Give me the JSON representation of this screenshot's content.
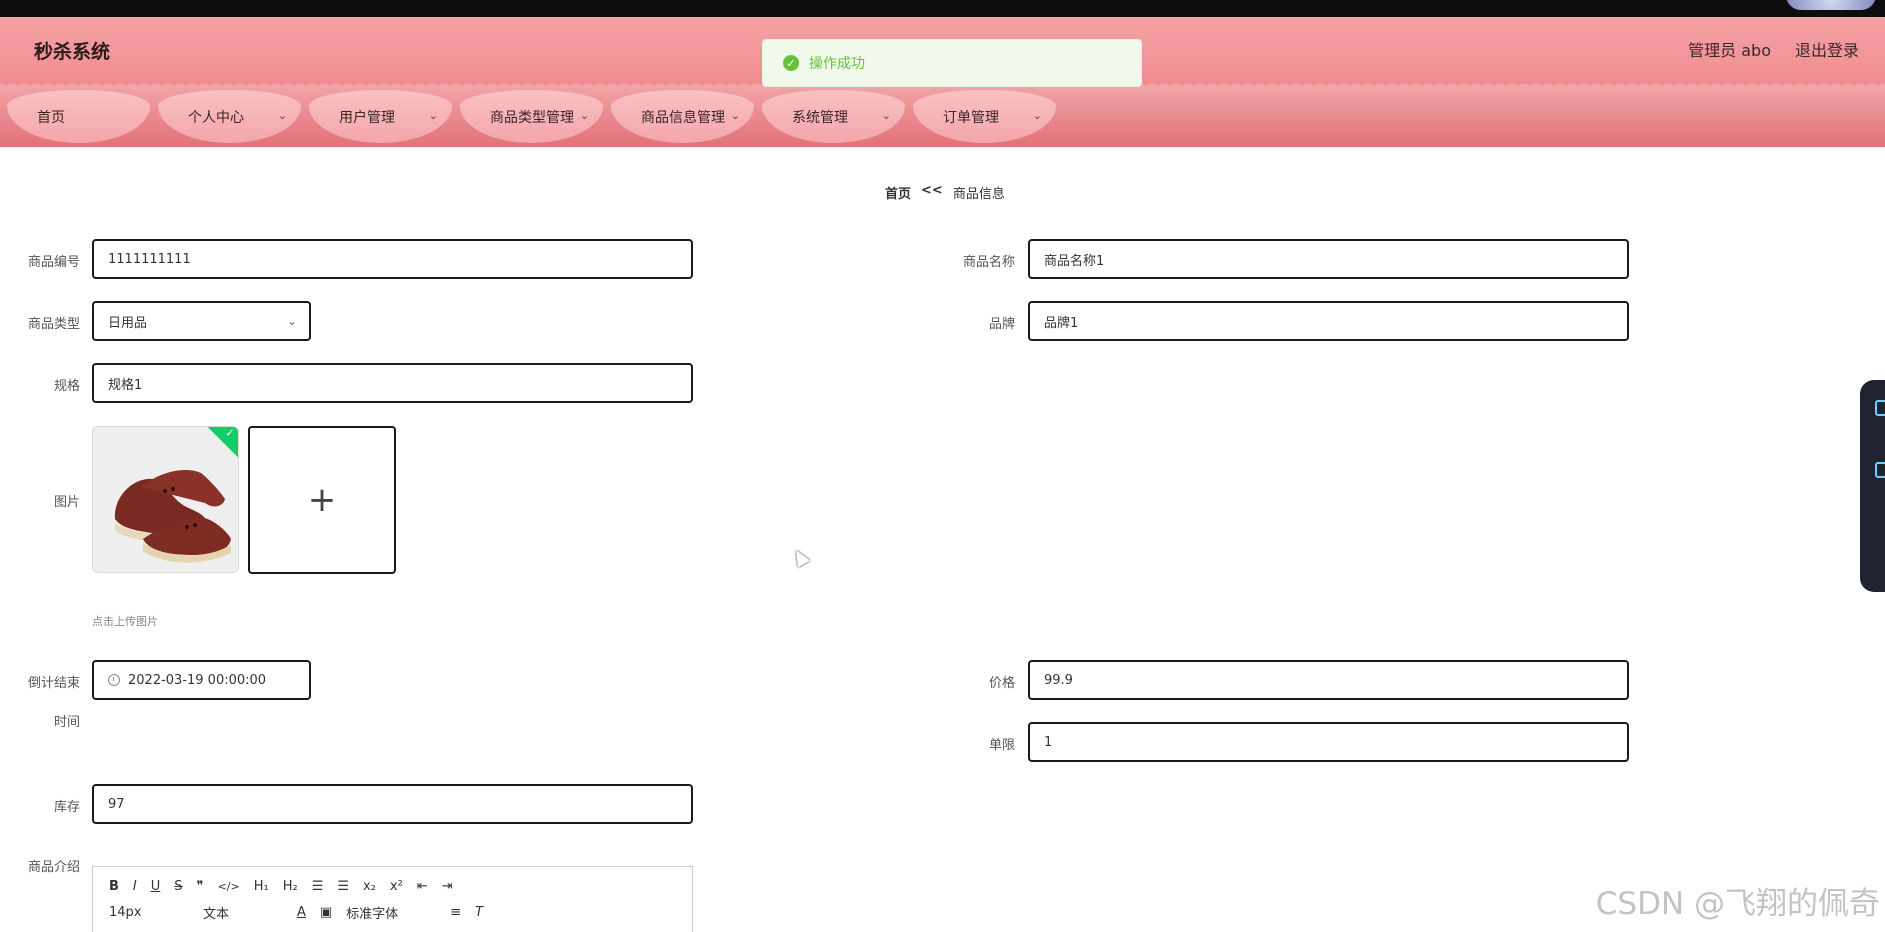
{
  "app": {
    "title": "秒杀系统"
  },
  "header": {
    "admin_label": "管理员 abo",
    "logout_label": "退出登录"
  },
  "toast": {
    "message": "操作成功",
    "color": "#67c23a"
  },
  "nav": {
    "items": [
      {
        "label": "首页",
        "has_dropdown": false
      },
      {
        "label": "个人中心",
        "has_dropdown": true
      },
      {
        "label": "用户管理",
        "has_dropdown": true
      },
      {
        "label": "商品类型管理",
        "has_dropdown": true
      },
      {
        "label": "商品信息管理",
        "has_dropdown": true
      },
      {
        "label": "系统管理",
        "has_dropdown": true
      },
      {
        "label": "订单管理",
        "has_dropdown": true
      }
    ]
  },
  "breadcrumb": {
    "home": "首页",
    "separator": "<<",
    "current": "商品信息"
  },
  "form": {
    "product_no": {
      "label": "商品编号",
      "value": "1111111111"
    },
    "product_name": {
      "label": "商品名称",
      "value": "商品名称1"
    },
    "product_type": {
      "label": "商品类型",
      "value": "日用品"
    },
    "brand": {
      "label": "品牌",
      "value": "品牌1"
    },
    "spec": {
      "label": "规格",
      "value": "规格1"
    },
    "image": {
      "label": "图片",
      "hint": "点击上传图片"
    },
    "end_time": {
      "label_line1": "倒计结束",
      "label_line2": "时间",
      "value": "2022-03-19 00:00:00"
    },
    "price": {
      "label": "价格",
      "value": "99.9"
    },
    "limit": {
      "label": "单限",
      "value": "1"
    },
    "stock": {
      "label": "库存",
      "value": "97"
    },
    "intro": {
      "label": "商品介绍"
    }
  },
  "editor_toolbar": {
    "row1": [
      "B",
      "I",
      "U",
      "S",
      "❞",
      "</>",
      "H₁",
      "H₂",
      "☰",
      "☰",
      "x₂",
      "x²",
      "⇤",
      "⇥"
    ],
    "font_size": "14px",
    "text_type": "文本",
    "font_family": "标准字体"
  },
  "watermark": "CSDN @飞翔的佩奇",
  "colors": {
    "header_pink": "#f18c91",
    "nav_pill": "#f7b3b6",
    "success": "#13ce66"
  }
}
